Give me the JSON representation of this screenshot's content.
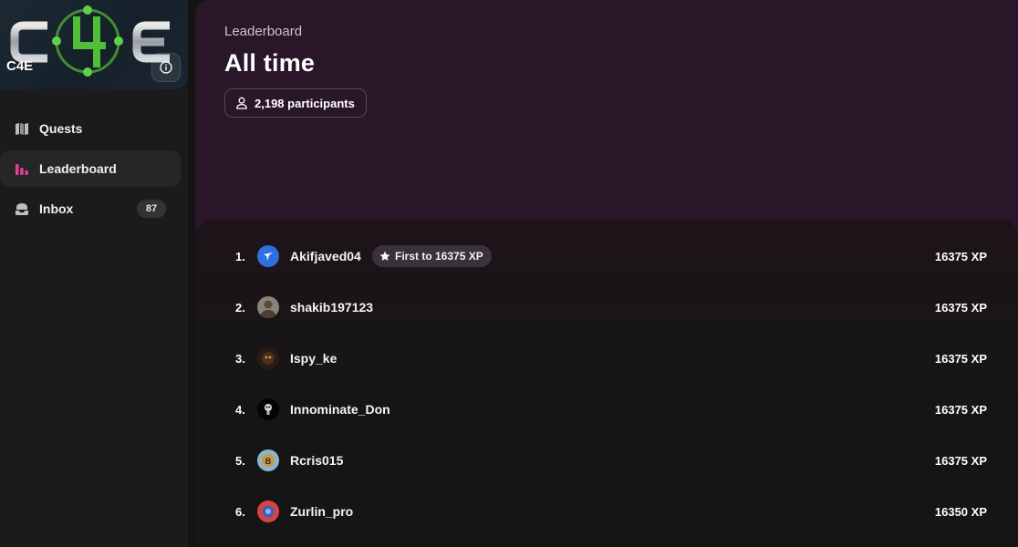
{
  "brand": {
    "logo_text": "C4E",
    "name": "C4E"
  },
  "sidebar": {
    "items": [
      {
        "label": "Quests",
        "icon": "map-icon",
        "active": false
      },
      {
        "label": "Leaderboard",
        "icon": "bar-chart-icon",
        "active": true,
        "icon_color": "#e0409a"
      },
      {
        "label": "Inbox",
        "icon": "inbox-icon",
        "active": false,
        "badge": "87"
      }
    ]
  },
  "header": {
    "breadcrumb": "Leaderboard",
    "title": "All time",
    "participants": "2,198 participants"
  },
  "leaderboard": {
    "rows": [
      {
        "rank": "1.",
        "name": "Akifjaved04",
        "xp": "16375 XP",
        "badge": "First to 16375 XP",
        "avatar_color": "#2f6fe0"
      },
      {
        "rank": "2.",
        "name": "shakib197123",
        "xp": "16375 XP",
        "avatar_color": "#8a8378"
      },
      {
        "rank": "3.",
        "name": "Ispy_ke",
        "xp": "16375 XP",
        "avatar_color": "#2a1b12"
      },
      {
        "rank": "4.",
        "name": "Innominate_Don",
        "xp": "16375 XP",
        "avatar_color": "#050505"
      },
      {
        "rank": "5.",
        "name": "Rcris015",
        "xp": "16375 XP",
        "avatar_color": "#c49a4a"
      },
      {
        "rank": "6.",
        "name": "Zurlin_pro",
        "xp": "16350 XP",
        "avatar_color": "#d9433f"
      }
    ]
  },
  "colors": {
    "hero_bg": "#2a1629",
    "accent": "#e0409a",
    "logo_green": "#4fbf3a"
  }
}
